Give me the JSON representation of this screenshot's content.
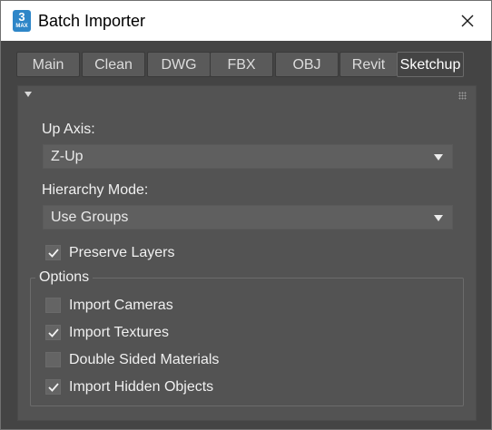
{
  "window": {
    "title": "Batch Importer",
    "icon": {
      "name": "3ds-max-app-icon",
      "number": "3",
      "sub": "MAX",
      "color": "#2e86c8"
    }
  },
  "tabs": [
    {
      "label": "Main",
      "active": false
    },
    {
      "label": "Clean",
      "active": false
    },
    {
      "label": "DWG",
      "active": false
    },
    {
      "label": "FBX",
      "active": false
    },
    {
      "label": "OBJ",
      "active": false
    },
    {
      "label": "Revit",
      "active": false
    },
    {
      "label": "Sketchup",
      "active": true
    }
  ],
  "rollout": {
    "up_axis": {
      "label": "Up Axis:",
      "value": "Z-Up"
    },
    "hierarchy_mode": {
      "label": "Hierarchy Mode:",
      "value": "Use Groups"
    },
    "preserve_layers": {
      "label": "Preserve Layers",
      "checked": true
    },
    "options": {
      "title": "Options",
      "items": [
        {
          "label": "Import Cameras",
          "checked": false
        },
        {
          "label": "Import Textures",
          "checked": true
        },
        {
          "label": "Double Sided Materials",
          "checked": false
        },
        {
          "label": "Import Hidden Objects",
          "checked": true
        }
      ]
    }
  }
}
